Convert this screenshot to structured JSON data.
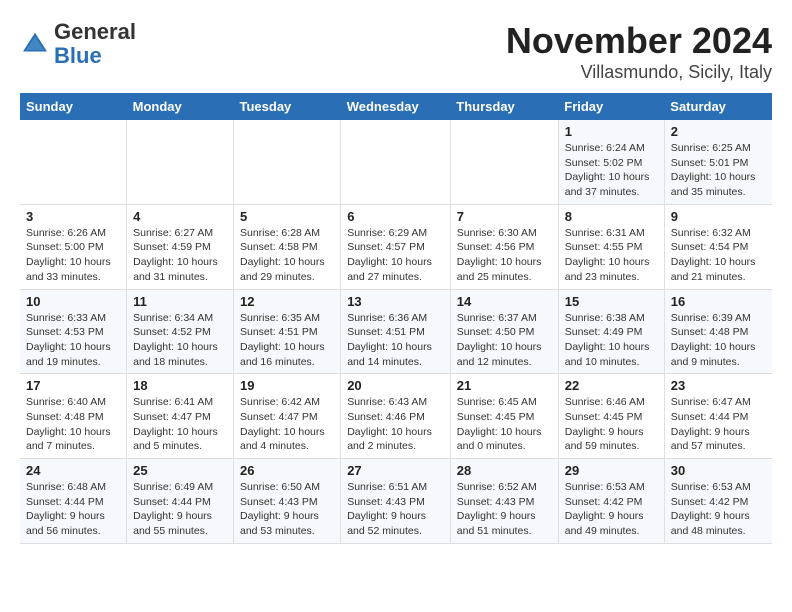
{
  "header": {
    "logo_general": "General",
    "logo_blue": "Blue",
    "month_title": "November 2024",
    "location": "Villasmundo, Sicily, Italy"
  },
  "weekdays": [
    "Sunday",
    "Monday",
    "Tuesday",
    "Wednesday",
    "Thursday",
    "Friday",
    "Saturday"
  ],
  "weeks": [
    [
      {
        "day": "",
        "info": ""
      },
      {
        "day": "",
        "info": ""
      },
      {
        "day": "",
        "info": ""
      },
      {
        "day": "",
        "info": ""
      },
      {
        "day": "",
        "info": ""
      },
      {
        "day": "1",
        "info": "Sunrise: 6:24 AM\nSunset: 5:02 PM\nDaylight: 10 hours and 37 minutes."
      },
      {
        "day": "2",
        "info": "Sunrise: 6:25 AM\nSunset: 5:01 PM\nDaylight: 10 hours and 35 minutes."
      }
    ],
    [
      {
        "day": "3",
        "info": "Sunrise: 6:26 AM\nSunset: 5:00 PM\nDaylight: 10 hours and 33 minutes."
      },
      {
        "day": "4",
        "info": "Sunrise: 6:27 AM\nSunset: 4:59 PM\nDaylight: 10 hours and 31 minutes."
      },
      {
        "day": "5",
        "info": "Sunrise: 6:28 AM\nSunset: 4:58 PM\nDaylight: 10 hours and 29 minutes."
      },
      {
        "day": "6",
        "info": "Sunrise: 6:29 AM\nSunset: 4:57 PM\nDaylight: 10 hours and 27 minutes."
      },
      {
        "day": "7",
        "info": "Sunrise: 6:30 AM\nSunset: 4:56 PM\nDaylight: 10 hours and 25 minutes."
      },
      {
        "day": "8",
        "info": "Sunrise: 6:31 AM\nSunset: 4:55 PM\nDaylight: 10 hours and 23 minutes."
      },
      {
        "day": "9",
        "info": "Sunrise: 6:32 AM\nSunset: 4:54 PM\nDaylight: 10 hours and 21 minutes."
      }
    ],
    [
      {
        "day": "10",
        "info": "Sunrise: 6:33 AM\nSunset: 4:53 PM\nDaylight: 10 hours and 19 minutes."
      },
      {
        "day": "11",
        "info": "Sunrise: 6:34 AM\nSunset: 4:52 PM\nDaylight: 10 hours and 18 minutes."
      },
      {
        "day": "12",
        "info": "Sunrise: 6:35 AM\nSunset: 4:51 PM\nDaylight: 10 hours and 16 minutes."
      },
      {
        "day": "13",
        "info": "Sunrise: 6:36 AM\nSunset: 4:51 PM\nDaylight: 10 hours and 14 minutes."
      },
      {
        "day": "14",
        "info": "Sunrise: 6:37 AM\nSunset: 4:50 PM\nDaylight: 10 hours and 12 minutes."
      },
      {
        "day": "15",
        "info": "Sunrise: 6:38 AM\nSunset: 4:49 PM\nDaylight: 10 hours and 10 minutes."
      },
      {
        "day": "16",
        "info": "Sunrise: 6:39 AM\nSunset: 4:48 PM\nDaylight: 10 hours and 9 minutes."
      }
    ],
    [
      {
        "day": "17",
        "info": "Sunrise: 6:40 AM\nSunset: 4:48 PM\nDaylight: 10 hours and 7 minutes."
      },
      {
        "day": "18",
        "info": "Sunrise: 6:41 AM\nSunset: 4:47 PM\nDaylight: 10 hours and 5 minutes."
      },
      {
        "day": "19",
        "info": "Sunrise: 6:42 AM\nSunset: 4:47 PM\nDaylight: 10 hours and 4 minutes."
      },
      {
        "day": "20",
        "info": "Sunrise: 6:43 AM\nSunset: 4:46 PM\nDaylight: 10 hours and 2 minutes."
      },
      {
        "day": "21",
        "info": "Sunrise: 6:45 AM\nSunset: 4:45 PM\nDaylight: 10 hours and 0 minutes."
      },
      {
        "day": "22",
        "info": "Sunrise: 6:46 AM\nSunset: 4:45 PM\nDaylight: 9 hours and 59 minutes."
      },
      {
        "day": "23",
        "info": "Sunrise: 6:47 AM\nSunset: 4:44 PM\nDaylight: 9 hours and 57 minutes."
      }
    ],
    [
      {
        "day": "24",
        "info": "Sunrise: 6:48 AM\nSunset: 4:44 PM\nDaylight: 9 hours and 56 minutes."
      },
      {
        "day": "25",
        "info": "Sunrise: 6:49 AM\nSunset: 4:44 PM\nDaylight: 9 hours and 55 minutes."
      },
      {
        "day": "26",
        "info": "Sunrise: 6:50 AM\nSunset: 4:43 PM\nDaylight: 9 hours and 53 minutes."
      },
      {
        "day": "27",
        "info": "Sunrise: 6:51 AM\nSunset: 4:43 PM\nDaylight: 9 hours and 52 minutes."
      },
      {
        "day": "28",
        "info": "Sunrise: 6:52 AM\nSunset: 4:43 PM\nDaylight: 9 hours and 51 minutes."
      },
      {
        "day": "29",
        "info": "Sunrise: 6:53 AM\nSunset: 4:42 PM\nDaylight: 9 hours and 49 minutes."
      },
      {
        "day": "30",
        "info": "Sunrise: 6:53 AM\nSunset: 4:42 PM\nDaylight: 9 hours and 48 minutes."
      }
    ]
  ]
}
